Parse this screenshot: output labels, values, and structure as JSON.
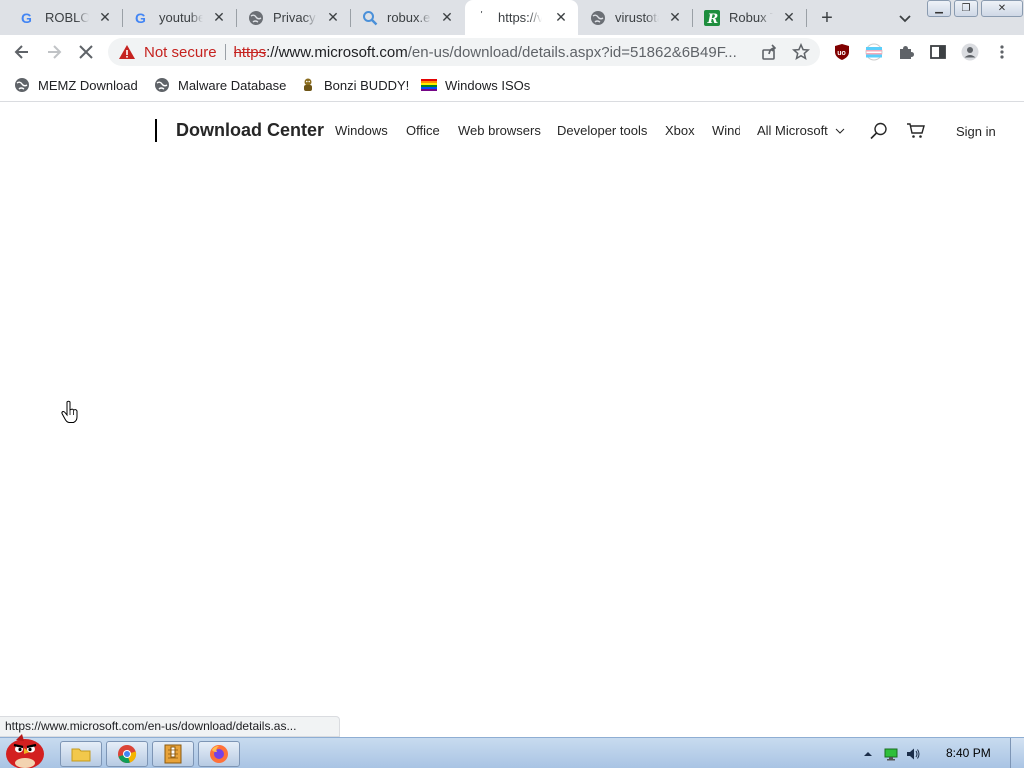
{
  "tabs": [
    {
      "title": "ROBLOX",
      "icon": "google-icon"
    },
    {
      "title": "youtube",
      "icon": "google-icon"
    },
    {
      "title": "Privacy e",
      "icon": "globe-icon"
    },
    {
      "title": "robux.ex",
      "icon": "search-icon"
    },
    {
      "title": "https://v",
      "icon": "loading-icon"
    },
    {
      "title": "virustota",
      "icon": "globe-icon"
    },
    {
      "title": "Robux T",
      "icon": "r-logo-icon"
    }
  ],
  "toolbar": {
    "security_text": "Not secure",
    "url_scheme": "https",
    "url_host": "://www.microsoft.com",
    "url_path": "/en-us/download/details.aspx?id=51862&6B49F..."
  },
  "bookmarks": [
    {
      "label": "MEMZ Download",
      "icon": "globe-icon"
    },
    {
      "label": "Malware Database",
      "icon": "globe-icon"
    },
    {
      "label": "Bonzi BUDDY!",
      "icon": "bonzi-icon"
    },
    {
      "label": "Windows ISOs",
      "icon": "rainbow-flag-icon"
    }
  ],
  "ms_header": {
    "brand": "Download Center",
    "nav": [
      "Windows",
      "Office",
      "Web browsers",
      "Developer tools",
      "Xbox",
      "Windows"
    ],
    "all_microsoft": "All Microsoft",
    "sign_in": "Sign in"
  },
  "status_url": "https://www.microsoft.com/en-us/download/details.as...",
  "taskbar": {
    "clock": "8:40 PM"
  },
  "colors": {
    "not_secure": "#c5221f",
    "tabstrip_bg": "#dee1e6",
    "taskbar_bg": "#b7cbe3"
  }
}
